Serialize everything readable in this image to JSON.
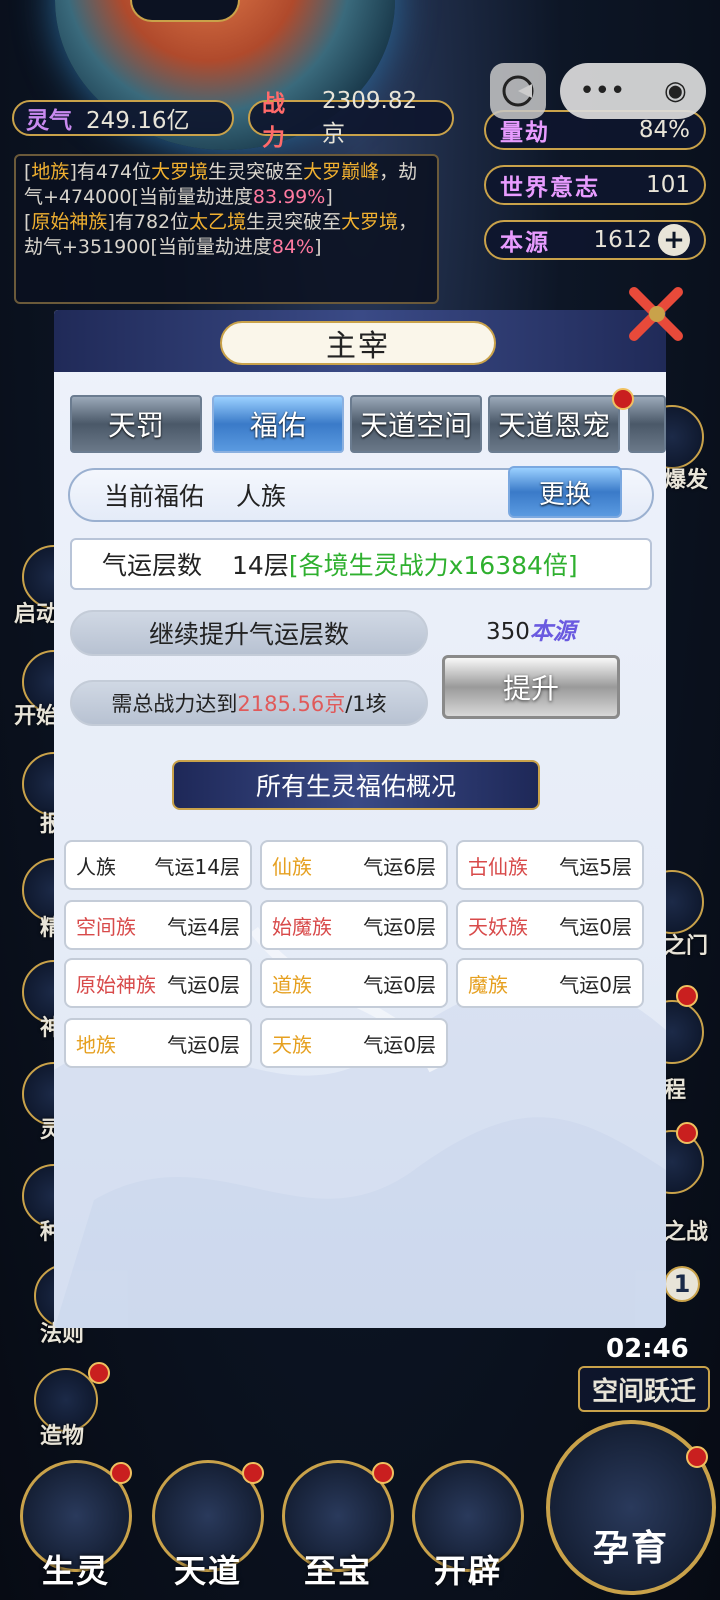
{
  "hud": {
    "lingqi_label": "灵气",
    "lingqi_value": "249.16亿",
    "zhanli_label": "战力",
    "zhanli_value": "2309.82京",
    "liangjie_label": "量劫",
    "liangjie_value": "84%",
    "shijie_label": "世界意志",
    "shijie_value": "101",
    "benyuan_label": "本源",
    "benyuan_value": "1612"
  },
  "log": {
    "l1_a": "[",
    "l1_race": "地族",
    "l1_b": "]有474位",
    "l1_realm": "大罗境",
    "l1_c": "生灵突破至",
    "l1_target": "大罗巅峰",
    "l1_d": "，劫气+474000[当前量劫进度",
    "l1_pct": "83.99%",
    "l1_e": "]",
    "l2_a": "[",
    "l2_race": "原始神族",
    "l2_b": "]有782位",
    "l2_realm": "太乙境",
    "l2_c": "生灵突破至",
    "l2_target": "大罗境",
    "l2_d": "，劫气+351900[当前量劫进度",
    "l2_pct": "84%",
    "l2_e": "]"
  },
  "side_left": [
    "启动",
    "开始",
    "报",
    "精",
    "神",
    "灵",
    "种",
    "法则",
    "造物"
  ],
  "side_right": [
    "爆发",
    "之门",
    "程",
    "之战",
    "空间跃迁"
  ],
  "timer": "02:46",
  "badge_count": "1",
  "bottom_nav": [
    "生灵",
    "天道",
    "至宝",
    "开辟",
    "孕育"
  ],
  "panel": {
    "title": "主宰",
    "tabs": [
      "天罚",
      "福佑",
      "天道空间",
      "天道恩宠"
    ],
    "current_label": "当前福佑",
    "current_value": "人族",
    "change_button": "更换",
    "luck_label": "气运层数",
    "luck_value": "14层",
    "luck_bonus": "[各境生灵战力x16384倍]",
    "upgrade_label": "继续提升气运层数",
    "cost_value": "350",
    "cost_unit": "本源",
    "req_prefix": "需总战力达到",
    "req_value": "2185.56京",
    "req_suffix": "/1垓",
    "upgrade_button": "提升",
    "section_title": "所有生灵福佑概况",
    "races": [
      {
        "name": "人族",
        "luck": "气运14层",
        "color": "#222222"
      },
      {
        "name": "仙族",
        "luck": "气运6层",
        "color": "#e6a020"
      },
      {
        "name": "古仙族",
        "luck": "气运5层",
        "color": "#d84a4a"
      },
      {
        "name": "空间族",
        "luck": "气运4层",
        "color": "#d84a4a"
      },
      {
        "name": "始魔族",
        "luck": "气运0层",
        "color": "#d84a4a"
      },
      {
        "name": "天妖族",
        "luck": "气运0层",
        "color": "#d84a4a"
      },
      {
        "name": "原始神族",
        "luck": "气运0层",
        "color": "#d84a4a"
      },
      {
        "name": "道族",
        "luck": "气运0层",
        "color": "#e6a020"
      },
      {
        "name": "魔族",
        "luck": "气运0层",
        "color": "#e6a020"
      },
      {
        "name": "地族",
        "luck": "气运0层",
        "color": "#e6a020"
      },
      {
        "name": "天族",
        "luck": "气运0层",
        "color": "#e6a020"
      }
    ]
  }
}
